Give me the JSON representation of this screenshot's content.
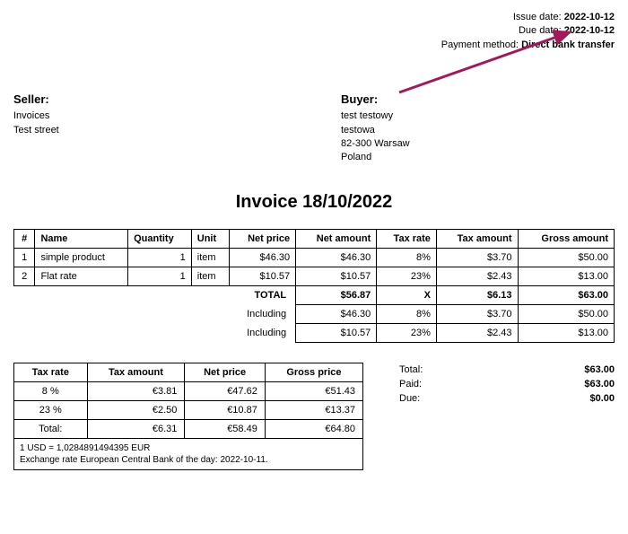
{
  "meta": {
    "issue_label": "Issue date:",
    "issue_date": "2022-10-12",
    "due_label": "Due date:",
    "due_date": "2022-10-12",
    "payment_label": "Payment method:",
    "payment_method": "Direct bank transfer"
  },
  "seller": {
    "heading": "Seller:",
    "name": "Invoices",
    "address": "Test street"
  },
  "buyer": {
    "heading": "Buyer:",
    "name": "test testowy",
    "street": "testowa",
    "city": "82-300 Warsaw",
    "country": "Poland"
  },
  "title": "Invoice 18/10/2022",
  "items_header": {
    "num": "#",
    "name": "Name",
    "qty": "Quantity",
    "unit": "Unit",
    "net_price": "Net price",
    "net_amount": "Net amount",
    "tax_rate": "Tax rate",
    "tax_amount": "Tax amount",
    "gross_amount": "Gross amount"
  },
  "items": [
    {
      "num": "1",
      "name": "simple product",
      "qty": "1",
      "unit": "item",
      "net_price": "$46.30",
      "net_amount": "$46.30",
      "tax_rate": "8%",
      "tax_amount": "$3.70",
      "gross_amount": "$50.00"
    },
    {
      "num": "2",
      "name": "Flat rate",
      "qty": "1",
      "unit": "item",
      "net_price": "$10.57",
      "net_amount": "$10.57",
      "tax_rate": "23%",
      "tax_amount": "$2.43",
      "gross_amount": "$13.00"
    }
  ],
  "total_row": {
    "label": "TOTAL",
    "net_amount": "$56.87",
    "tax_rate": "X",
    "tax_amount": "$6.13",
    "gross_amount": "$63.00"
  },
  "including": [
    {
      "label": "Including",
      "net_amount": "$46.30",
      "tax_rate": "8%",
      "tax_amount": "$3.70",
      "gross_amount": "$50.00"
    },
    {
      "label": "Including",
      "net_amount": "$10.57",
      "tax_rate": "23%",
      "tax_amount": "$2.43",
      "gross_amount": "$13.00"
    }
  ],
  "tax_header": {
    "rate": "Tax rate",
    "amount": "Tax amount",
    "net": "Net price",
    "gross": "Gross price"
  },
  "tax_rows": [
    {
      "rate": "8 %",
      "amount": "€3.81",
      "net": "€47.62",
      "gross": "€51.43"
    },
    {
      "rate": "23 %",
      "amount": "€2.50",
      "net": "€10.87",
      "gross": "€13.37"
    },
    {
      "rate": "Total:",
      "amount": "€6.31",
      "net": "€58.49",
      "gross": "€64.80"
    }
  ],
  "exchange": {
    "line1": "1 USD = 1,0284891494395 EUR",
    "line2": "Exchange rate European Central Bank of the day: 2022-10-11."
  },
  "totals": {
    "total_label": "Total:",
    "total_value": "$63.00",
    "paid_label": "Paid:",
    "paid_value": "$63.00",
    "due_label": "Due:",
    "due_value": "$0.00"
  }
}
